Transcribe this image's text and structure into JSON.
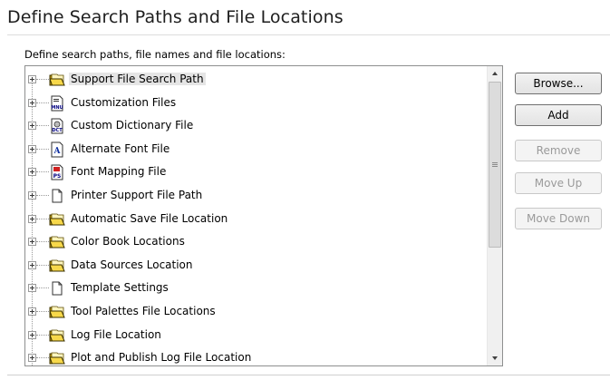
{
  "header": {
    "title": "Define Search Paths and File Locations"
  },
  "tree": {
    "prompt": "Define search paths, file names and file locations:",
    "items": [
      {
        "label": "Support File Search Path",
        "icon": "folder-icon",
        "selected": true
      },
      {
        "label": "Customization Files",
        "icon": "mnu-file-icon"
      },
      {
        "label": "Custom Dictionary File",
        "icon": "dct-file-icon"
      },
      {
        "label": "Alternate Font File",
        "icon": "font-file-icon"
      },
      {
        "label": "Font Mapping File",
        "icon": "ps-file-icon"
      },
      {
        "label": "Printer Support File Path",
        "icon": "blank-document-icon"
      },
      {
        "label": "Automatic Save File Location",
        "icon": "folder-icon"
      },
      {
        "label": "Color Book Locations",
        "icon": "folder-icon"
      },
      {
        "label": "Data Sources Location",
        "icon": "folder-icon"
      },
      {
        "label": "Template Settings",
        "icon": "blank-document-icon"
      },
      {
        "label": "Tool Palettes File Locations",
        "icon": "folder-icon"
      },
      {
        "label": "Log File Location",
        "icon": "folder-icon"
      },
      {
        "label": "Plot and Publish Log File Location",
        "icon": "folder-icon"
      }
    ]
  },
  "buttons": {
    "browse": "Browse...",
    "add": "Add",
    "remove": "Remove",
    "move_up": "Move Up",
    "move_down": "Move Down"
  },
  "icon_labels": {
    "mnu": "MNU",
    "dct": "DCT",
    "ps": "PS",
    "font": "A"
  }
}
